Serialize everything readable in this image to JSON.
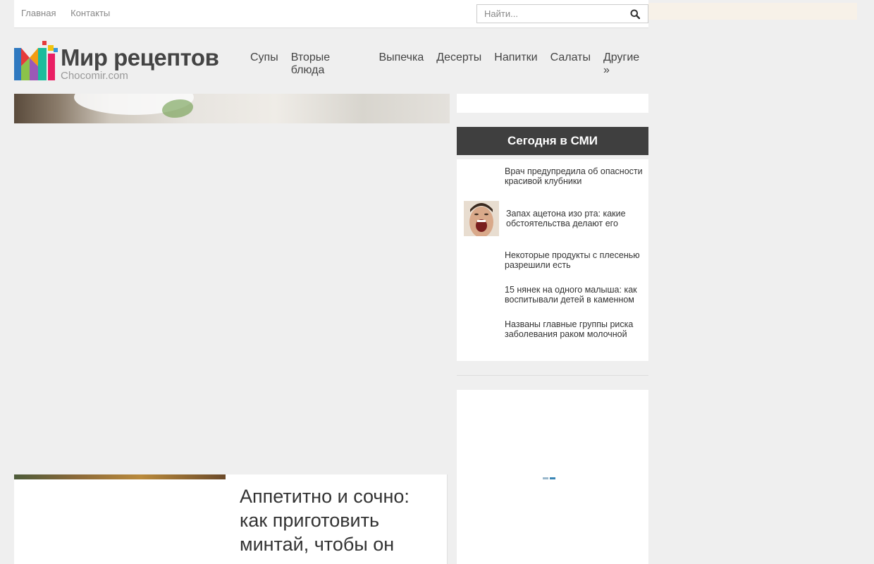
{
  "topbar": {
    "links": [
      "Главная",
      "Контакты"
    ],
    "search_placeholder": "Найти..."
  },
  "header": {
    "brand": "Мир рецептов",
    "domain": "Chocomir.com",
    "nav": [
      "Супы",
      "Вторые блюда",
      "Выпечка",
      "Десерты",
      "Напитки",
      "Салаты",
      "Другие »"
    ]
  },
  "sidebar": {
    "smi_title": "Сегодня в СМИ",
    "smi_items": [
      "Врач предупредила об опасности красивой клубники",
      "Запах ацетона изо рта: какие обстоятельства делают его",
      "Некоторые продукты с плесенью разрешили есть",
      "15 нянек на одного малыша: как воспитывали детей в каменном",
      "Названы главные группы риска заболевания раком молочной"
    ]
  },
  "article": {
    "title": "Аппетитно и сочно: как приготовить минтай, чтобы он"
  },
  "colors": {
    "smi_header_bg": "#3f3f3f",
    "background": "#efefef",
    "loader_accent": "#3a86b5"
  },
  "icons": {
    "search": "search-icon",
    "logo": "logo-icon"
  }
}
